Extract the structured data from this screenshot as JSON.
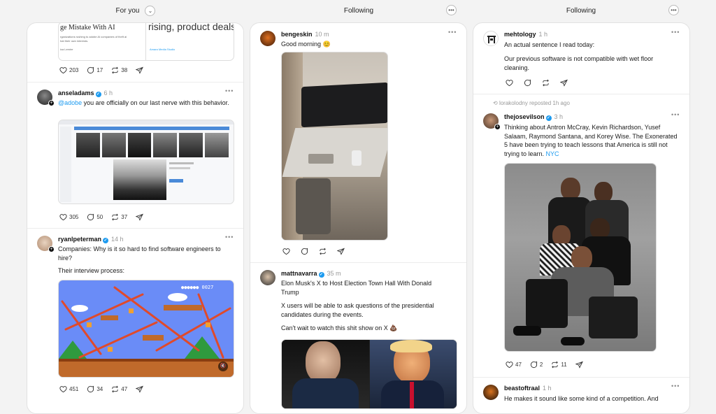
{
  "headers": [
    {
      "label": "For you",
      "has_dropdown": true
    },
    {
      "label": "Following",
      "has_more": true
    },
    {
      "label": "Following",
      "has_more": true
    }
  ],
  "col1": {
    "top_post": {
      "image_text_1": "ge Mistake With AI",
      "image_text_2": "rising, product deals",
      "image_small_lines": [
        "rganizations rushing to adobe AI companies of theft ai",
        "hat their own interests.",
        "ica Lemire"
      ],
      "image_link": "Amara Media Studio",
      "likes": "203",
      "replies": "17",
      "reposts": "38"
    },
    "post2": {
      "username": "anseladams",
      "time": "6 h",
      "mention": "@adobe",
      "text": " you are officially on our last nerve with this behavior.",
      "likes": "305",
      "replies": "50",
      "reposts": "37"
    },
    "post3": {
      "username": "ryanlpeterman",
      "time": "14 h",
      "line1": "Companies: Why is it so hard to find software engineers to hire?",
      "line2": "Their interview process:",
      "likes": "451",
      "replies": "34",
      "reposts": "47"
    }
  },
  "col2": {
    "post1": {
      "username": "bengeskin",
      "time": "10 m",
      "text": "Good morning 😊"
    },
    "post2": {
      "username": "mattnavarra",
      "time": "35 m",
      "line1": "Elon Musk's X to Host Election Town Hall With Donald Trump",
      "line2": "X users will be able to ask questions of the presidential candidates during the events.",
      "line3": "Can't wait to watch this shit show on X 💩"
    }
  },
  "col3": {
    "post1": {
      "username": "mehtology",
      "time": "1 h",
      "line1": "An actual sentence I read today:",
      "line2": "Our previous software is not compatible with wet floor cleaning."
    },
    "post2": {
      "repost_text": "lorakolodny reposted 1h ago",
      "username": "thejosevilson",
      "time": "3 h",
      "text": "Thinking about Antron McCray, Kevin Richardson, Yusef Salaam, Raymond Santana, and Korey Wise. The Exonerated 5 have been trying to teach lessons that America is still not trying to learn. ",
      "hashtag": "NYC",
      "likes": "47",
      "replies": "2",
      "reposts": "11"
    },
    "post3": {
      "username": "beastoftraal",
      "time": "1 h",
      "text": "He makes it sound like some kind of a competition. And"
    }
  },
  "colors": {
    "accent": "#1d9bf0",
    "background": "#f3f3f3",
    "card": "#ffffff"
  }
}
